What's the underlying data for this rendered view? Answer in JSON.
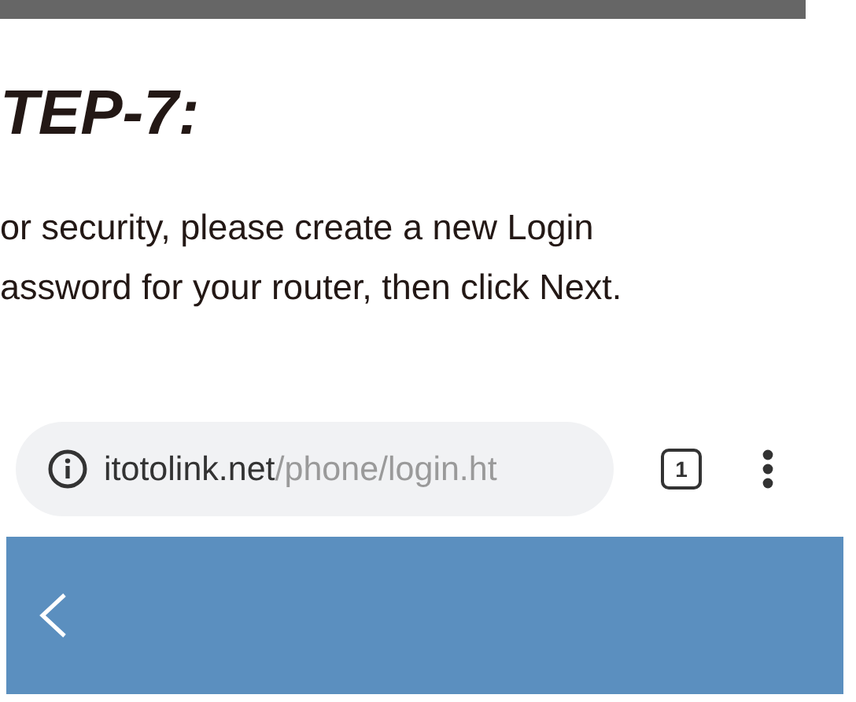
{
  "step_heading": "TEP-7:",
  "instructions": [
    "or security, please create a new Login",
    "assword for your router, then click Next."
  ],
  "browser": {
    "address_bar": {
      "domain": "itotolink.net",
      "path": "/phone/login.ht"
    },
    "tab_count": "1"
  }
}
